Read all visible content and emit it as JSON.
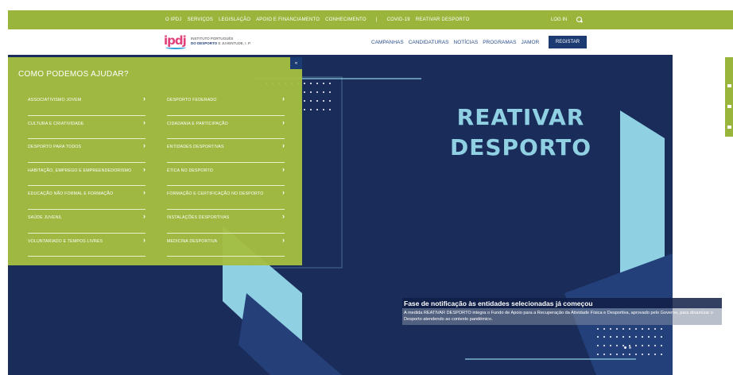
{
  "topbar": {
    "items": [
      "O IPDJ",
      "SERVIÇOS",
      "LEGISLAÇÃO",
      "APOIO E FINANCIAMENTO",
      "CONHECIMENTO",
      "COVID-19",
      "REATIVAR DESPORTO"
    ],
    "login": "LOG IN"
  },
  "header": {
    "logo_short": "ipdj",
    "logo_line1": "INSTITUTO PORTUGUÊS",
    "logo_line2a": "DO DESPORTO",
    "logo_line2b": "E JUVENTUDE",
    "logo_line2c": ", I. P.",
    "nav": [
      "CAMPANHAS",
      "CANDIDATURAS",
      "NOTÍCIAS",
      "PROGRAMAS",
      "JAMOR"
    ],
    "register": "REGISTAR"
  },
  "help": {
    "title": "COMO PODEMOS AJUDAR?",
    "close": "«",
    "col1": [
      "ASSOCIATIVISMO JOVEM",
      "CULTURA E CRIATIVIDADE",
      "DESPORTO PARA TODOS",
      "HABITAÇÃO, EMPREGO E EMPREENDEDORISMO",
      "EDUCAÇÃO NÃO FORMAL E FORMAÇÃO",
      "SAÚDE JUVENIL",
      "VOLUNTARIADO E TEMPOS LIVRES"
    ],
    "col2": [
      "DESPORTO FEDERADO",
      "CIDADANIA E PARTICIPAÇÃO",
      "ENTIDADES DESPORTIVAS",
      "ÉTICA NO DESPORTO",
      "FORMAÇÃO E CERTIFICAÇÃO NO DESPORTO",
      "INSTALAÇÕES DESPORTIVAS",
      "MEDICINA DESPORTIVA"
    ],
    "arrow": "›"
  },
  "hero": {
    "title_line1": "REATIVAR",
    "title_line2": "DESPORTO",
    "caption_title": "Fase de notificação às entidades selecionadas já começou",
    "caption_text": "A medida REATIVAR DESPORTO integra o Fundo de Apoio para a Recuperação da Atividade Física e Desportiva, aprovado pelo Governo, para dinamizar o Desporto atendendo ao contexto pandémico.",
    "slides": 2,
    "active_slide": 1
  },
  "colors": {
    "green": "#99b53b",
    "navy": "#1a2c5a",
    "light_blue": "#8fd0e3",
    "button": "#1b3b72"
  }
}
